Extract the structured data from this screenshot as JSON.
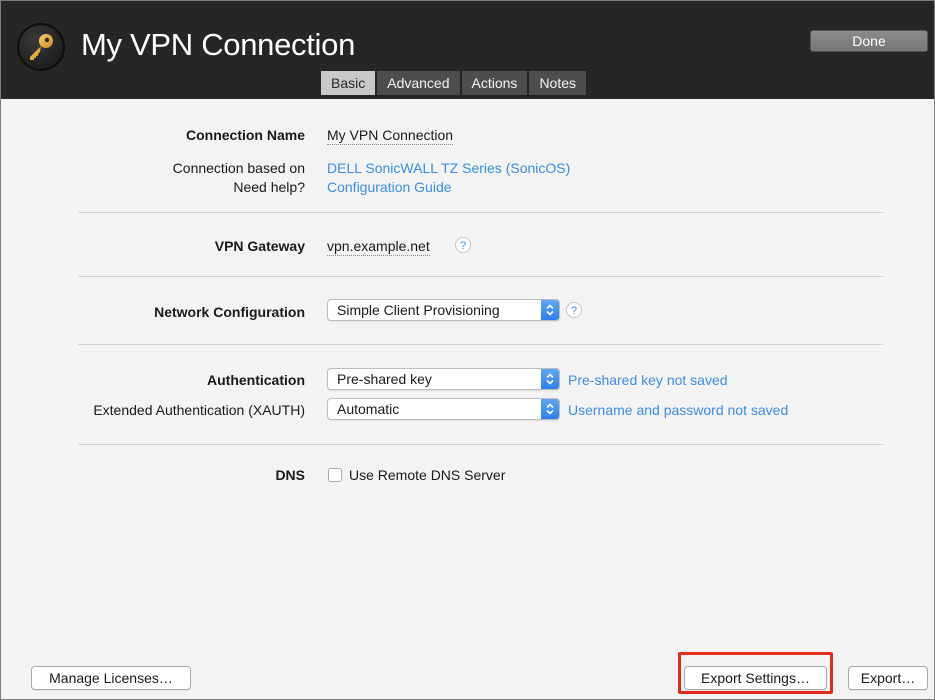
{
  "window": {
    "title": "My VPN Connection",
    "done_label": "Done"
  },
  "tabs": [
    {
      "label": "Basic",
      "active": true
    },
    {
      "label": "Advanced",
      "active": false
    },
    {
      "label": "Actions",
      "active": false
    },
    {
      "label": "Notes",
      "active": false
    }
  ],
  "form": {
    "connection_name": {
      "label": "Connection Name",
      "value": "My VPN Connection"
    },
    "based_on": {
      "label": "Connection based on",
      "value": "DELL SonicWALL TZ Series (SonicOS)"
    },
    "help": {
      "label": "Need help?",
      "value": "Configuration Guide"
    },
    "gateway": {
      "label": "VPN Gateway",
      "value": "vpn.example.net",
      "help_glyph": "?"
    },
    "network": {
      "label": "Network Configuration",
      "selected": "Simple Client Provisioning",
      "help_glyph": "?"
    },
    "authentication": {
      "label": "Authentication",
      "selected": "Pre-shared key",
      "status": "Pre-shared key not saved"
    },
    "xauth": {
      "label": "Extended Authentication (XAUTH)",
      "selected": "Automatic",
      "status": "Username and password not saved"
    },
    "dns": {
      "label": "DNS",
      "checkbox_label": "Use Remote DNS Server",
      "checked": false
    }
  },
  "footer": {
    "manage_licenses": "Manage Licenses…",
    "export_settings": "Export Settings…",
    "export": "Export…"
  },
  "colors": {
    "header_bg": "#262626",
    "link": "#3b8de2",
    "highlight": "#e22b1c",
    "popup_accent": "#2d7ef0"
  },
  "icons": {
    "app": "key-icon",
    "popup": "up-down-chevron-icon",
    "help": "help-icon"
  }
}
